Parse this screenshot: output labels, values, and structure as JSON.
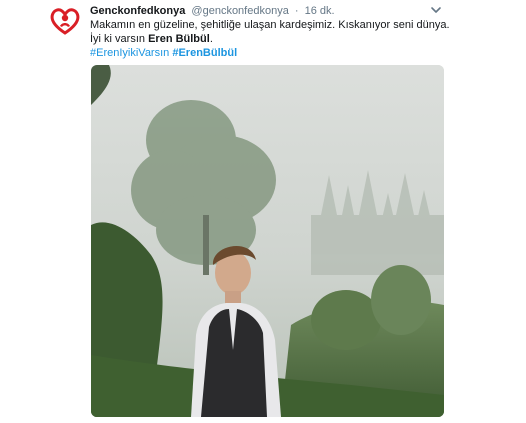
{
  "tweet": {
    "display_name": "Genckonfedkonya",
    "handle": "@genckonfedkonya",
    "separator": "·",
    "timestamp": "16 dk.",
    "text_line1": "Makamın en güzeline, şehitliğe ulaşan kardeşimiz. Kıskanıyor seni dünya.",
    "text_line2_prefix": "İyi ki varsın ",
    "text_line2_name": "Eren Bülbül",
    "text_line2_suffix": ".",
    "hashtags": [
      "#ErenIyikiVarsın",
      "#ErenBülbül"
    ]
  },
  "icons": {
    "avatar": "red-heart-logo-icon",
    "caret": "chevron-down-icon"
  },
  "colors": {
    "text": "#14171a",
    "secondary": "#657786",
    "link": "#1b95e0",
    "logo_red": "#d91f26"
  }
}
